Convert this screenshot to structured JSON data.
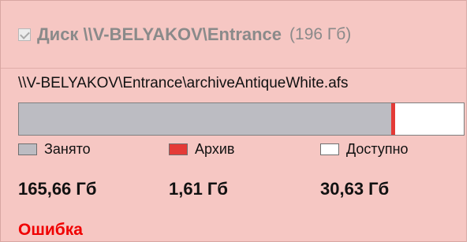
{
  "disk": {
    "title": "Диск \\\\V-BELYAKOV\\Entrance",
    "size_label": "(196 Гб)",
    "checked": true
  },
  "file_path": "\\\\V-BELYAKOV\\Entrance\\archiveAntiqueWhite.afs",
  "usage": {
    "used_fraction": 0.845,
    "archive_fraction": 0.008,
    "free_fraction": 0.156
  },
  "legend": {
    "used_label": "Занято",
    "archive_label": "Архив",
    "free_label": "Доступно",
    "used_color": "#bcbcc2",
    "archive_color": "#e43a36",
    "free_color": "#ffffff"
  },
  "values": {
    "used": "165,66 Гб",
    "archive": "1,61 Гб",
    "free": "30,63 Гб"
  },
  "status": {
    "error": "Ошибка"
  },
  "icons": {
    "checkbox": "checkbox-checked-icon"
  }
}
